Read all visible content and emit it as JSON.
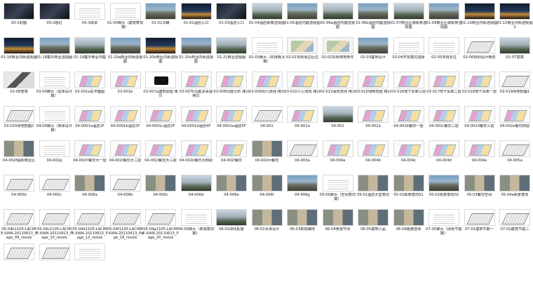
{
  "items": [
    {
      "label": "00-1封面",
      "thumb": "dark"
    },
    {
      "label": "00-2题记",
      "thumb": "dark"
    },
    {
      "label": "00-3目录",
      "thumb": "doc"
    },
    {
      "label": "01-00扉页（建筑表现篇）",
      "thumb": "doc"
    },
    {
      "label": "01-01鸟瞰",
      "thumb": "photo"
    },
    {
      "label": "01-02酒店入口",
      "thumb": "night"
    },
    {
      "label": "01-03酒店入口",
      "thumb": "dark"
    },
    {
      "label": "01-04酒店街角透视图",
      "thumb": "photo2"
    },
    {
      "label": "01-05酒店内庭透视图",
      "thumb": "photo"
    },
    {
      "label": "01-06a酒店内庭透视图",
      "thumb": "photo2"
    },
    {
      "label": "01-06b酒店内庭透视图",
      "thumb": "photo"
    },
    {
      "label": "01-07商业区城街景透视图",
      "thumb": "photo2"
    },
    {
      "label": "01-09商业区城街景透视图",
      "thumb": "photo"
    },
    {
      "label": "01-10商业内街透视图",
      "thumb": "night"
    },
    {
      "label": "01-15商业内街透视图2",
      "thumb": "night"
    },
    {
      "label": "01-16商业内街透视图",
      "thumb": "night"
    },
    {
      "label": "01-18集中商业透视图",
      "thumb": "photo"
    },
    {
      "label": "01-19集中商业中庭",
      "thumb": "photo2"
    },
    {
      "label": "01-20a商业内街透视图",
      "thumb": "photo"
    },
    {
      "label": "01-20b商业内街透视图",
      "thumb": "night"
    },
    {
      "label": "01-20c商业内街透视图",
      "thumb": "photo"
    },
    {
      "label": "01-21商业透视图",
      "thumb": "photo2"
    },
    {
      "label": "02-00扉页（项目概况篇）",
      "thumb": "doc"
    },
    {
      "label": "02-01项目周边区位",
      "thumb": "map"
    },
    {
      "label": "02-02项目用地条件",
      "thumb": "map"
    },
    {
      "label": "02-03基地设计",
      "thumb": "photo"
    },
    {
      "label": "02-04开发模式选择",
      "thumb": "doc"
    },
    {
      "label": "02-05项目定位",
      "thumb": "doc"
    },
    {
      "label": "02-06规划设计概念",
      "thumb": "diag"
    },
    {
      "label": "02-07意境",
      "thumb": "photo2"
    },
    {
      "label": "02-08意境",
      "thumb": "bw"
    },
    {
      "label": "03-00扉页（总体设计篇）",
      "thumb": "doc"
    },
    {
      "label": "03-001a总平面图",
      "thumb": "plan"
    },
    {
      "label": "03-001b",
      "thumb": "plan"
    },
    {
      "label": "03-007a建筑肌理 拷贝",
      "thumb": "logo"
    },
    {
      "label": "03-007b功能关系图 拷贝",
      "thumb": "plan"
    },
    {
      "label": "03-008功能分析 拷贝",
      "thumb": "plan"
    },
    {
      "label": "03-009车行流线 拷贝",
      "thumb": "plan"
    },
    {
      "label": "03-010人行流线 拷贝",
      "thumb": "plan"
    },
    {
      "label": "03-013消防流线 拷贝",
      "thumb": "plan"
    },
    {
      "label": "03-015地库范围 拷贝",
      "thumb": "plan"
    },
    {
      "label": "03-016地下车库三层",
      "thumb": "plan"
    },
    {
      "label": "03-017地下车库二层",
      "thumb": "plan"
    },
    {
      "label": "03-018地下车库一层",
      "thumb": "plan"
    },
    {
      "label": "03-019场地剖面1",
      "thumb": "diag"
    },
    {
      "label": "03-020场地剖面2",
      "thumb": "diag"
    },
    {
      "label": "04-00扉页（单体设计篇）",
      "thumb": "doc"
    },
    {
      "label": "04-0001a酒店1F",
      "thumb": "plan"
    },
    {
      "label": "04-0001b酒店2F",
      "thumb": "plan"
    },
    {
      "label": "04-0001c酒店3F",
      "thumb": "plan"
    },
    {
      "label": "04-0001d酒店4F",
      "thumb": "plan"
    },
    {
      "label": "04-0001e酒店5F",
      "thumb": "plan"
    },
    {
      "label": "04-001",
      "thumb": "diag"
    },
    {
      "label": "04-001a",
      "thumb": "plan"
    },
    {
      "label": "04-002",
      "thumb": "photo2"
    },
    {
      "label": "04-002a",
      "thumb": "plan"
    },
    {
      "label": "04-002b餐饮一层",
      "thumb": "plan"
    },
    {
      "label": "04-002c餐饮二层",
      "thumb": "plan"
    },
    {
      "label": "04-002d餐饮三层",
      "thumb": "plan"
    },
    {
      "label": "04-002e餐饮四层",
      "thumb": "plan"
    },
    {
      "label": "04-002f临街商业区",
      "thumb": "collage"
    },
    {
      "label": "04-002g",
      "thumb": "doc"
    },
    {
      "label": "04-002h餐饮大一层",
      "thumb": "plan"
    },
    {
      "label": "04-002i餐饮大二层",
      "thumb": "plan"
    },
    {
      "label": "04-002j餐饮大三层",
      "thumb": "plan"
    },
    {
      "label": "04-002k餐饮大四层",
      "thumb": "plan"
    },
    {
      "label": "04-002l餐饮",
      "thumb": "plan"
    },
    {
      "label": "04-002m餐饮",
      "thumb": "collage"
    },
    {
      "label": "04-003a",
      "thumb": "diag"
    },
    {
      "label": "04-004a",
      "thumb": "plan"
    },
    {
      "label": "04-004b",
      "thumb": "plan"
    },
    {
      "label": "04-004c",
      "thumb": "plan"
    },
    {
      "label": "04-004d",
      "thumb": "plan"
    },
    {
      "label": "04-004e",
      "thumb": "plan"
    },
    {
      "label": "04-005a",
      "thumb": "diag"
    },
    {
      "label": "04-005b",
      "thumb": "diag"
    },
    {
      "label": "04-005c",
      "thumb": "diag"
    },
    {
      "label": "04-006a",
      "thumb": "collage"
    },
    {
      "label": "04-006b",
      "thumb": "diag"
    },
    {
      "label": "04-006c",
      "thumb": "collage"
    },
    {
      "label": "04-006d",
      "thumb": "photo2"
    },
    {
      "label": "04-006e",
      "thumb": "collage"
    },
    {
      "label": "04-006f",
      "thumb": "collage"
    },
    {
      "label": "04-006g",
      "thumb": "photo"
    },
    {
      "label": "05-00扉页（空间意向篇）",
      "thumb": "doc"
    },
    {
      "label": "05-01酒店大堂意向",
      "thumb": "collage"
    },
    {
      "label": "05-02街景意向01",
      "thumb": "collage"
    },
    {
      "label": "05-02街景意向02",
      "thumb": "photo"
    },
    {
      "label": "05-03餐饮空间",
      "thumb": "collage"
    },
    {
      "label": "05-04a街景意向",
      "thumb": "collage"
    },
    {
      "label": "05-04b1105-LACIME-XIAN-20110613_Page_09_resize",
      "thumb": "diag"
    },
    {
      "label": "05-04c1105-LACIME-XIAN-20110613_Page_10_resize",
      "thumb": "diag"
    },
    {
      "label": "05-04d1105-LACIME-XIAN-20110613_Page_12_resize",
      "thumb": "diag"
    },
    {
      "label": "05-04f1105-LACIME-XIAN-20110613_Page_18_resize",
      "thumb": "diag"
    },
    {
      "label": "05-04g1105-LACIME-XIAN-20110613_Page_20_resize",
      "thumb": "diag"
    },
    {
      "label": "06-00扉页（景观意向篇）",
      "thumb": "doc"
    },
    {
      "label": "06-01绿化配置",
      "thumb": "photo2"
    },
    {
      "label": "06-02水体设计",
      "thumb": "collage"
    },
    {
      "label": "06-03景观铺地",
      "thumb": "collage"
    },
    {
      "label": "06-04景观节点",
      "thumb": "collage"
    },
    {
      "label": "06-05建筑小品",
      "thumb": "collage"
    },
    {
      "label": "06-06植被选择",
      "thumb": "collage"
    },
    {
      "label": "07-00扉页（绿色节能篇）",
      "thumb": "doc"
    },
    {
      "label": "07-01建筑节能一",
      "thumb": "diag"
    },
    {
      "label": "07-02建筑节能二",
      "thumb": "diag"
    },
    {
      "label": "",
      "thumb": "diag"
    },
    {
      "label": "",
      "thumb": "diag"
    },
    {
      "label": "",
      "thumb": "doc"
    }
  ]
}
